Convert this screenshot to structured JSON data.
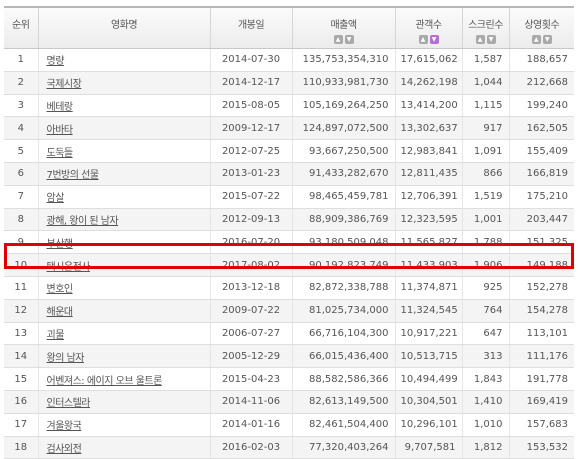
{
  "header": {
    "rank": "순위",
    "title": "영화명",
    "release": "개봉일",
    "sales": "매출액",
    "audience": "관객수",
    "screens": "스크린수",
    "showings": "상영횟수"
  },
  "sort_arrows": {
    "up": "▲",
    "down": "▼"
  },
  "highlight_color": "#e00000",
  "active_sort_color": "#b56fd2",
  "rows": [
    {
      "rank": "1",
      "title": "명량",
      "date": "2014-07-30",
      "sales": "135,753,354,310",
      "audience": "17,615,062",
      "screens": "1,587",
      "showings": "188,657"
    },
    {
      "rank": "2",
      "title": "국제시장",
      "date": "2014-12-17",
      "sales": "110,933,981,730",
      "audience": "14,262,198",
      "screens": "1,044",
      "showings": "212,668"
    },
    {
      "rank": "3",
      "title": "베테랑",
      "date": "2015-08-05",
      "sales": "105,169,264,250",
      "audience": "13,414,200",
      "screens": "1,115",
      "showings": "199,240"
    },
    {
      "rank": "4",
      "title": "아바타",
      "date": "2009-12-17",
      "sales": "124,897,072,500",
      "audience": "13,302,637",
      "screens": "917",
      "showings": "162,505"
    },
    {
      "rank": "5",
      "title": "도둑들",
      "date": "2012-07-25",
      "sales": "93,667,250,500",
      "audience": "12,983,841",
      "screens": "1,091",
      "showings": "155,409"
    },
    {
      "rank": "6",
      "title": "7번방의 선물",
      "date": "2013-01-23",
      "sales": "91,433,282,670",
      "audience": "12,811,435",
      "screens": "866",
      "showings": "166,819"
    },
    {
      "rank": "7",
      "title": "암살",
      "date": "2015-07-22",
      "sales": "98,465,459,781",
      "audience": "12,706,391",
      "screens": "1,519",
      "showings": "175,210"
    },
    {
      "rank": "8",
      "title": "광해, 왕이 된 남자",
      "date": "2012-09-13",
      "sales": "88,909,386,769",
      "audience": "12,323,595",
      "screens": "1,001",
      "showings": "203,447"
    },
    {
      "rank": "9",
      "title": "부산행",
      "date": "2016-07-20",
      "sales": "93,180,509,048",
      "audience": "11,565,827",
      "screens": "1,788",
      "showings": "151,325"
    },
    {
      "rank": "10",
      "title": "택시운전사",
      "date": "2017-08-02",
      "sales": "90,192,823,749",
      "audience": "11,433,903",
      "screens": "1,906",
      "showings": "149,188"
    },
    {
      "rank": "11",
      "title": "변호인",
      "date": "2013-12-18",
      "sales": "82,872,338,788",
      "audience": "11,374,871",
      "screens": "925",
      "showings": "152,278"
    },
    {
      "rank": "12",
      "title": "해운대",
      "date": "2009-07-22",
      "sales": "81,025,734,000",
      "audience": "11,324,545",
      "screens": "764",
      "showings": "154,278"
    },
    {
      "rank": "13",
      "title": "괴물",
      "date": "2006-07-27",
      "sales": "66,716,104,300",
      "audience": "10,917,221",
      "screens": "647",
      "showings": "113,101"
    },
    {
      "rank": "14",
      "title": "왕의 남자",
      "date": "2005-12-29",
      "sales": "66,015,436,400",
      "audience": "10,513,715",
      "screens": "313",
      "showings": "111,176"
    },
    {
      "rank": "15",
      "title": "어벤져스: 에이지 오브 울트론",
      "date": "2015-04-23",
      "sales": "88,582,586,366",
      "audience": "10,494,499",
      "screens": "1,843",
      "showings": "191,778"
    },
    {
      "rank": "16",
      "title": "인터스텔라",
      "date": "2014-11-06",
      "sales": "82,613,149,500",
      "audience": "10,304,501",
      "screens": "1,410",
      "showings": "169,419"
    },
    {
      "rank": "17",
      "title": "겨울왕국",
      "date": "2014-01-16",
      "sales": "82,461,504,400",
      "audience": "10,296,101",
      "screens": "1,010",
      "showings": "157,683"
    },
    {
      "rank": "18",
      "title": "검사외전",
      "date": "2016-02-03",
      "sales": "77,320,403,264",
      "audience": "9,707,581",
      "screens": "1,812",
      "showings": "153,532"
    }
  ]
}
